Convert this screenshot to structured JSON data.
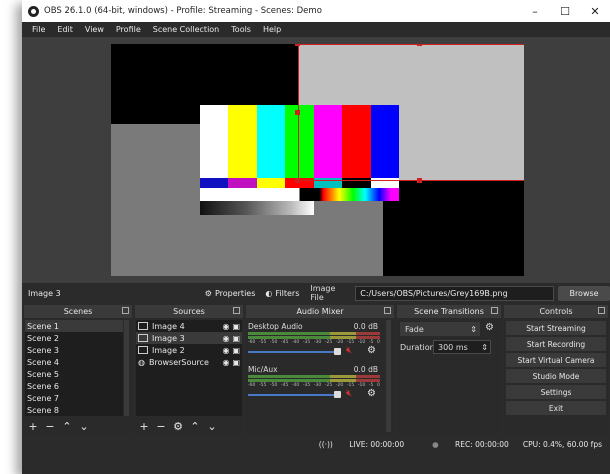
{
  "window": {
    "title": "OBS 26.1.0 (64-bit, windows) - Profile: Streaming - Scenes: Demo",
    "minimize": "–",
    "maximize": "☐",
    "close": "✕"
  },
  "menu": [
    "File",
    "Edit",
    "View",
    "Profile",
    "Scene Collection",
    "Tools",
    "Help"
  ],
  "controls_bar": {
    "selected_source": "Image 3",
    "properties": "Properties",
    "filters": "Filters",
    "image_file_label": "Image File",
    "image_path": "C:/Users/OBS/Pictures/Grey169B.png",
    "browse": "Browse"
  },
  "scenes": {
    "title": "Scenes",
    "items": [
      "Scene 1",
      "Scene 2",
      "Scene 3",
      "Scene 4",
      "Scene 5",
      "Scene 6",
      "Scene 7",
      "Scene 8"
    ],
    "selected": 0
  },
  "sources": {
    "title": "Sources",
    "items": [
      "Image 4",
      "Image 3",
      "Image 2",
      "BrowserSource"
    ],
    "selected": 1
  },
  "mixer": {
    "title": "Audio Mixer",
    "channels": [
      {
        "name": "Desktop Audio",
        "db": "0.0 dB"
      },
      {
        "name": "Mic/Aux",
        "db": "0.0 dB"
      }
    ],
    "scale": [
      "-60",
      "-55",
      "-50",
      "-45",
      "-40",
      "-35",
      "-30",
      "-25",
      "-20",
      "-15",
      "-10",
      "-5",
      "0"
    ]
  },
  "transitions": {
    "title": "Scene Transitions",
    "transition": "Fade",
    "duration_label": "Duration",
    "duration": "300 ms"
  },
  "controls": {
    "title": "Controls",
    "buttons": [
      "Start Streaming",
      "Start Recording",
      "Start Virtual Camera",
      "Studio Mode",
      "Settings",
      "Exit"
    ]
  },
  "status": {
    "live": "LIVE: 00:00:00",
    "rec": "REC: 00:00:00",
    "cpu": "CPU: 0.4%, 60.00 fps"
  },
  "colors": {
    "selection": "#d02020",
    "bg": "#2b2b2b",
    "panel": "#1e1e1e"
  }
}
